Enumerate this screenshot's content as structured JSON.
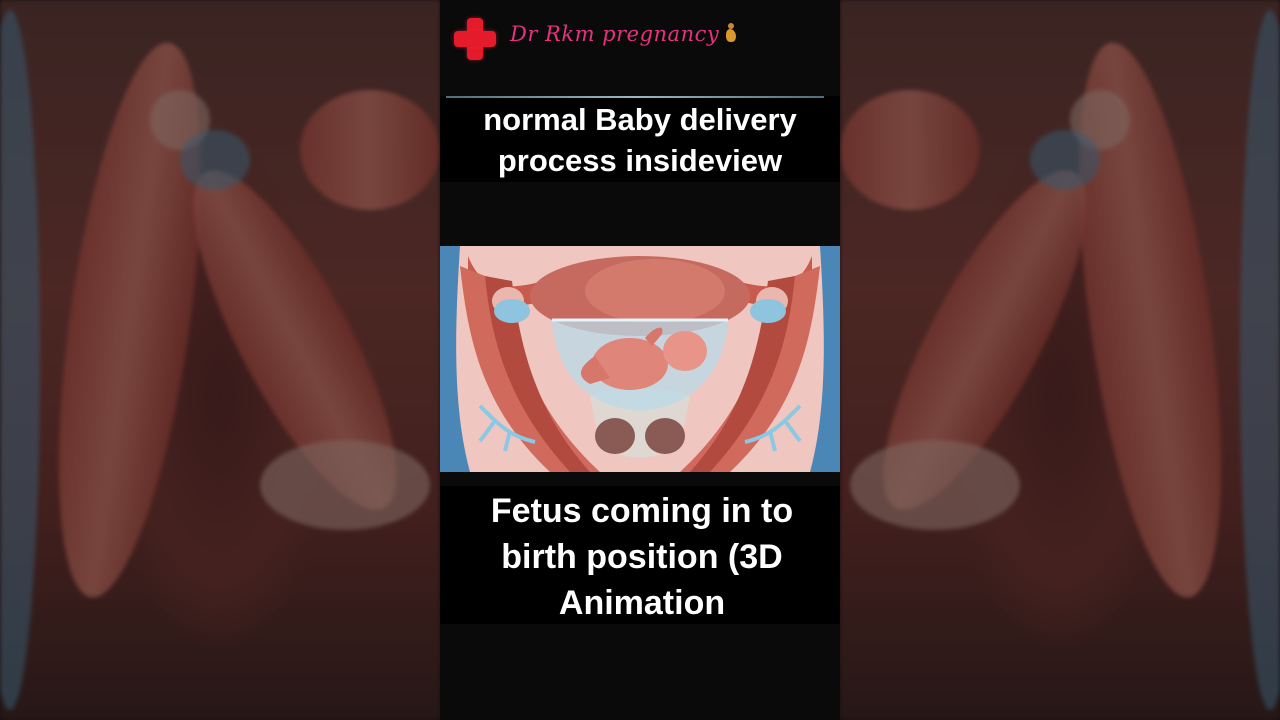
{
  "video": {
    "channel_name": "Dr Rkm pregnancy",
    "channel_icon": "red-cross-icon",
    "channel_emoji_icon": "pregnant-woman-icon",
    "top_caption": "normal Baby delivery process insideview",
    "bottom_caption": "Fetus coming in to birth position (3D Animation",
    "illustration": "fetus-in-uterus-3d-illustration"
  },
  "colors": {
    "brand_pink": "#e6327d",
    "cross_red": "#e41b2b",
    "caption_text": "#ffffff",
    "caption_bg": "#000000",
    "panel_bg": "#0a0a0a"
  }
}
